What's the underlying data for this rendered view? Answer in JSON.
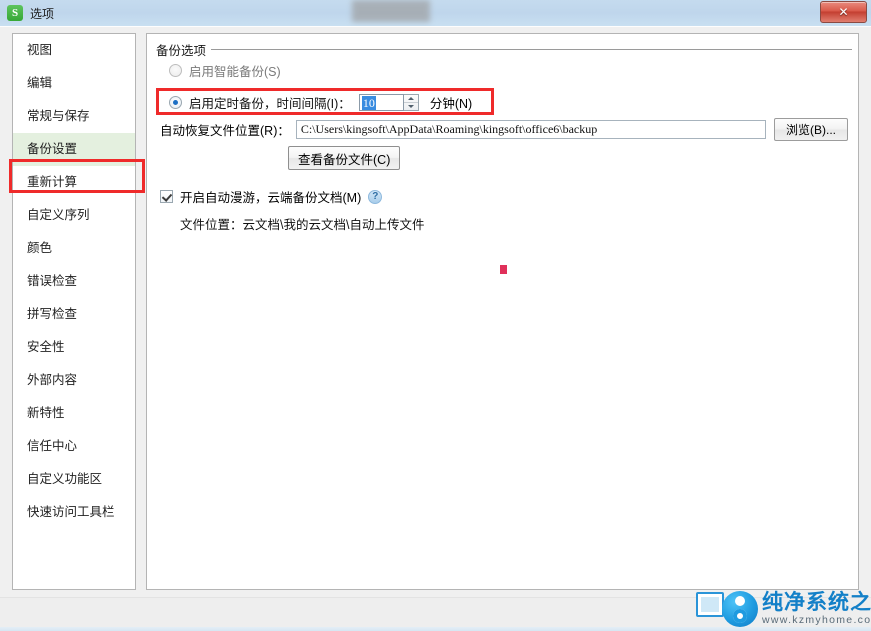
{
  "window": {
    "title": "选项",
    "app_icon": "S",
    "close_label": "✕"
  },
  "sidebar": {
    "items": [
      {
        "label": "视图",
        "selected": false
      },
      {
        "label": "编辑",
        "selected": false
      },
      {
        "label": "常规与保存",
        "selected": false
      },
      {
        "label": "备份设置",
        "selected": true
      },
      {
        "label": "重新计算",
        "selected": false
      },
      {
        "label": "自定义序列",
        "selected": false
      },
      {
        "label": "颜色",
        "selected": false
      },
      {
        "label": "错误检查",
        "selected": false
      },
      {
        "label": "拼写检查",
        "selected": false
      },
      {
        "label": "安全性",
        "selected": false
      },
      {
        "label": "外部内容",
        "selected": false
      },
      {
        "label": "新特性",
        "selected": false
      },
      {
        "label": "信任中心",
        "selected": false
      },
      {
        "label": "自定义功能区",
        "selected": false
      },
      {
        "label": "快速访问工具栏",
        "selected": false
      }
    ]
  },
  "content": {
    "group_title": "备份选项",
    "smart_backup": {
      "label": "启用智能备份(S)",
      "checked": false
    },
    "timed_backup": {
      "label": "启用定时备份，时间间隔(I)：",
      "checked": true,
      "interval_value": "10",
      "minutes_label": "分钟(N)"
    },
    "recovery_path": {
      "label": "自动恢复文件位置(R)：",
      "value": "C:\\Users\\kingsoft\\AppData\\Roaming\\kingsoft\\office6\\backup",
      "browse_label": "浏览(B)..."
    },
    "view_backup_label": "查看备份文件(C)",
    "auto_roam": {
      "label": "开启自动漫游，云端备份文档(M)",
      "checked": true,
      "help_glyph": "?",
      "sub_label": "文件位置：云文档\\我的云文档\\自动上传文件"
    }
  },
  "watermark": {
    "title": "纯净系统之家",
    "url": "www.kzmyhome.com"
  },
  "colors": {
    "annotation_red": "#ef2a2a",
    "selected_sidebar_bg": "#e4f0df",
    "radio_accent": "#1c6fc4",
    "input_selection": "#3a8ce0",
    "watermark_blue": "#1380c8"
  }
}
